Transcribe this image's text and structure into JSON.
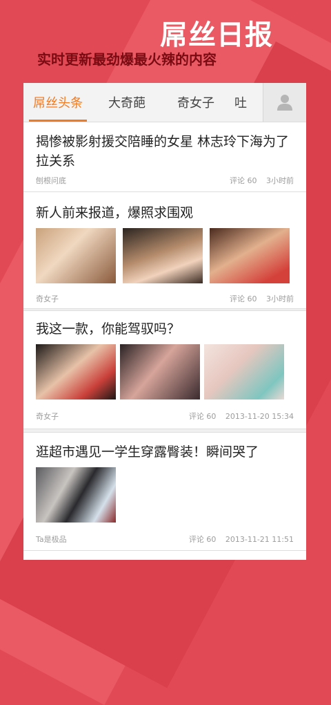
{
  "header": {
    "app_title": "屌丝日报",
    "subtitle": "实时更新最劲爆最火辣的内容"
  },
  "tabs": [
    {
      "label": "屌丝头条",
      "active": true
    },
    {
      "label": "大奇葩",
      "active": false
    },
    {
      "label": "奇女子",
      "active": false
    },
    {
      "label": "吐",
      "active": false
    }
  ],
  "profile_icon": "person-icon",
  "feed": [
    {
      "title": "揭惨被影射援交陪睡的女星 林志玲下海为了拉关系",
      "source": "刨根问底",
      "comments": "评论 60",
      "time": "3小时前"
    },
    {
      "title": "新人前来报道，爆照求围观",
      "source": "奇女子",
      "comments": "评论 60",
      "time": "3小时前"
    },
    {
      "title": "我这一款，你能驾驭吗？",
      "source": "奇女子",
      "comments": "评论 60",
      "time": "2013-11-20 15:34"
    },
    {
      "title": "逛超市遇见一学生穿露臀装！瞬间哭了",
      "source": "Ta是极品",
      "comments": "评论 60",
      "time": "2013-11-21 11:51"
    }
  ],
  "colors": {
    "background": "#e14a55",
    "accent": "#f27a21",
    "subtitle": "#7a0b12"
  }
}
